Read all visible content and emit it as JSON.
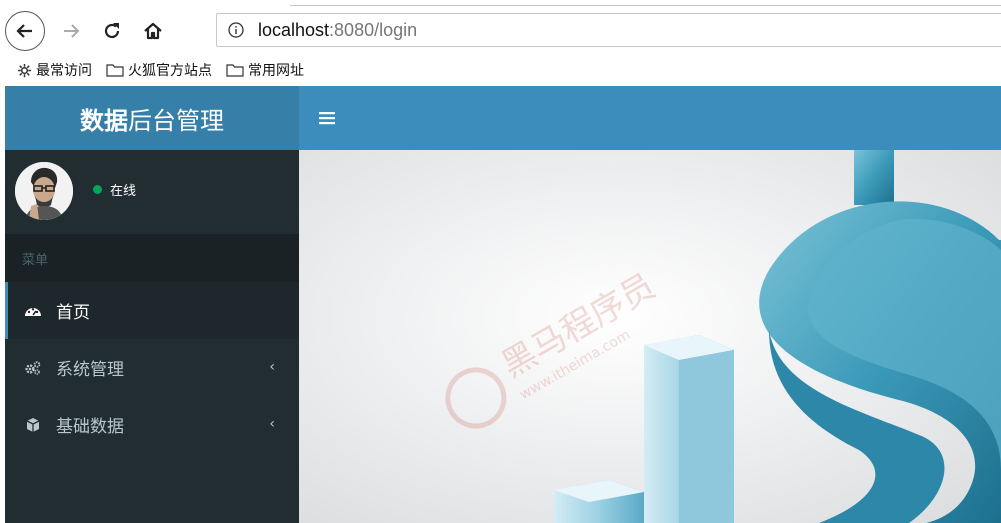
{
  "browser": {
    "url_host": "localhost",
    "url_path": ":8080/login",
    "bookmarks": [
      {
        "label": "最常访问",
        "icon": "gear-icon"
      },
      {
        "label": "火狐官方站点",
        "icon": "folder-icon"
      },
      {
        "label": "常用网址",
        "icon": "folder-icon"
      }
    ]
  },
  "app": {
    "logo_bold": "数据",
    "logo_rest": "后台管理",
    "user_status": "在线",
    "menu_header": "菜单",
    "menu": [
      {
        "label": "首页",
        "icon": "dashboard-icon",
        "active": true
      },
      {
        "label": "系统管理",
        "icon": "cogs-icon",
        "has_children": true
      },
      {
        "label": "基础数据",
        "icon": "cube-icon",
        "has_children": true
      }
    ],
    "watermark_text": "黑马程序员",
    "watermark_url": "www.itheima.com"
  },
  "colors": {
    "logo_bg": "#367fa9",
    "navbar_bg": "#3c8dbc",
    "sidebar_bg": "#222d32",
    "status_dot": "#00a65a"
  }
}
